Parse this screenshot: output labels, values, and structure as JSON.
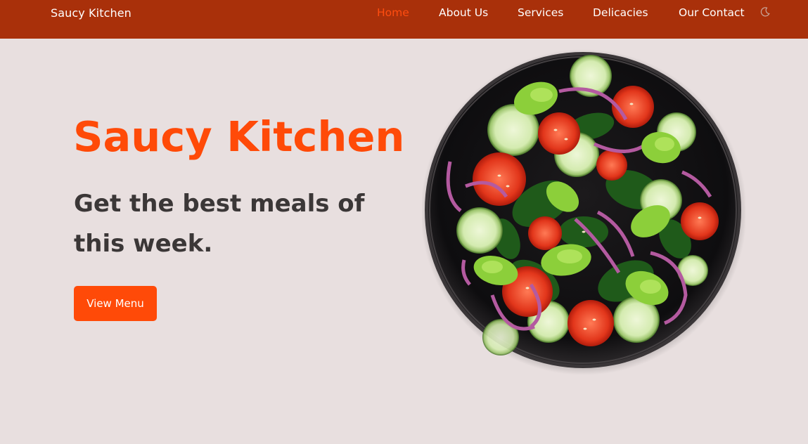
{
  "navbar": {
    "brand": "Saucy Kitchen",
    "links": [
      "Home",
      "About Us",
      "Services",
      "Delicacies",
      "Our Contact"
    ],
    "active_link": "Home",
    "theme_icon": "moon-icon"
  },
  "hero": {
    "title": "Saucy Kitchen",
    "subtitle": "Get the best meals of this week.",
    "button_label": "View Menu"
  },
  "colors": {
    "navbar_bg": "#a9300a",
    "accent": "#ff4a08",
    "page_bg": "#e8dfdf",
    "text_dark": "#3b3737"
  },
  "image": {
    "subject": "salad-bowl"
  }
}
